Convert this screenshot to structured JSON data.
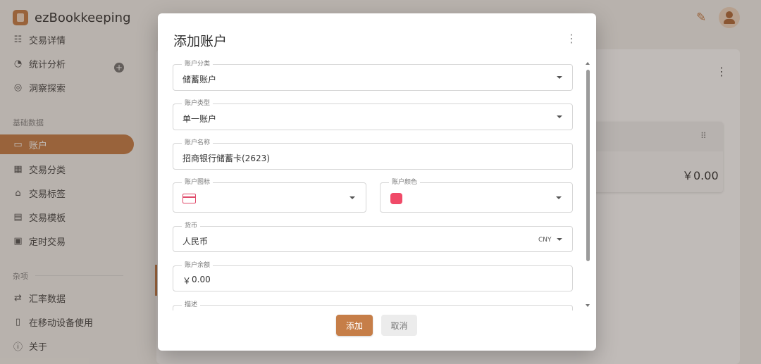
{
  "app": {
    "title": "ezBookkeeping",
    "logo_icon": "book-icon",
    "top_icons": [
      "magic-wand-off-icon",
      "user-avatar-icon"
    ]
  },
  "sidebar": {
    "items_top": [
      {
        "label": "交易详情",
        "icon": "list-details-icon"
      },
      {
        "label": "统计分析",
        "icon": "chart-pie-icon"
      },
      {
        "label": "洞察探索",
        "icon": "compass-icon"
      }
    ],
    "section_basic": "基础数据",
    "items_basic": [
      {
        "label": "账户",
        "icon": "credit-card-icon",
        "active": true
      },
      {
        "label": "交易分类",
        "icon": "category-grid-icon"
      },
      {
        "label": "交易标签",
        "icon": "tag-icon"
      },
      {
        "label": "交易模板",
        "icon": "clipboard-icon"
      },
      {
        "label": "定时交易",
        "icon": "calendar-clock-icon"
      }
    ],
    "section_misc": "杂项",
    "items_misc": [
      {
        "label": "汇率数据",
        "icon": "exchange-arrows-icon"
      },
      {
        "label": "在移动设备使用",
        "icon": "mobile-phone-icon"
      },
      {
        "label": "关于",
        "icon": "info-circle-icon"
      }
    ]
  },
  "main": {
    "account_balance": "￥0.00"
  },
  "dialog": {
    "title": "添加账户",
    "fields": {
      "category": {
        "label": "账户分类",
        "value": "储蓄账户"
      },
      "type": {
        "label": "账户类型",
        "value": "单一账户"
      },
      "name": {
        "label": "账户名称",
        "value": "招商银行储蓄卡(2623)"
      },
      "icon": {
        "label": "账户图标",
        "value_icon": "credit-card-icon"
      },
      "color": {
        "label": "账户颜色",
        "value_color": "#f04a68"
      },
      "currency": {
        "label": "货币",
        "value": "人民币",
        "code": "CNY"
      },
      "balance": {
        "label": "账户余额",
        "symbol": "￥",
        "value": "0.00"
      },
      "description": {
        "label": "描述"
      }
    },
    "buttons": {
      "add": "添加",
      "cancel": "取消"
    }
  },
  "colors": {
    "accent": "#c67e48",
    "swatch": "#f04a68"
  }
}
